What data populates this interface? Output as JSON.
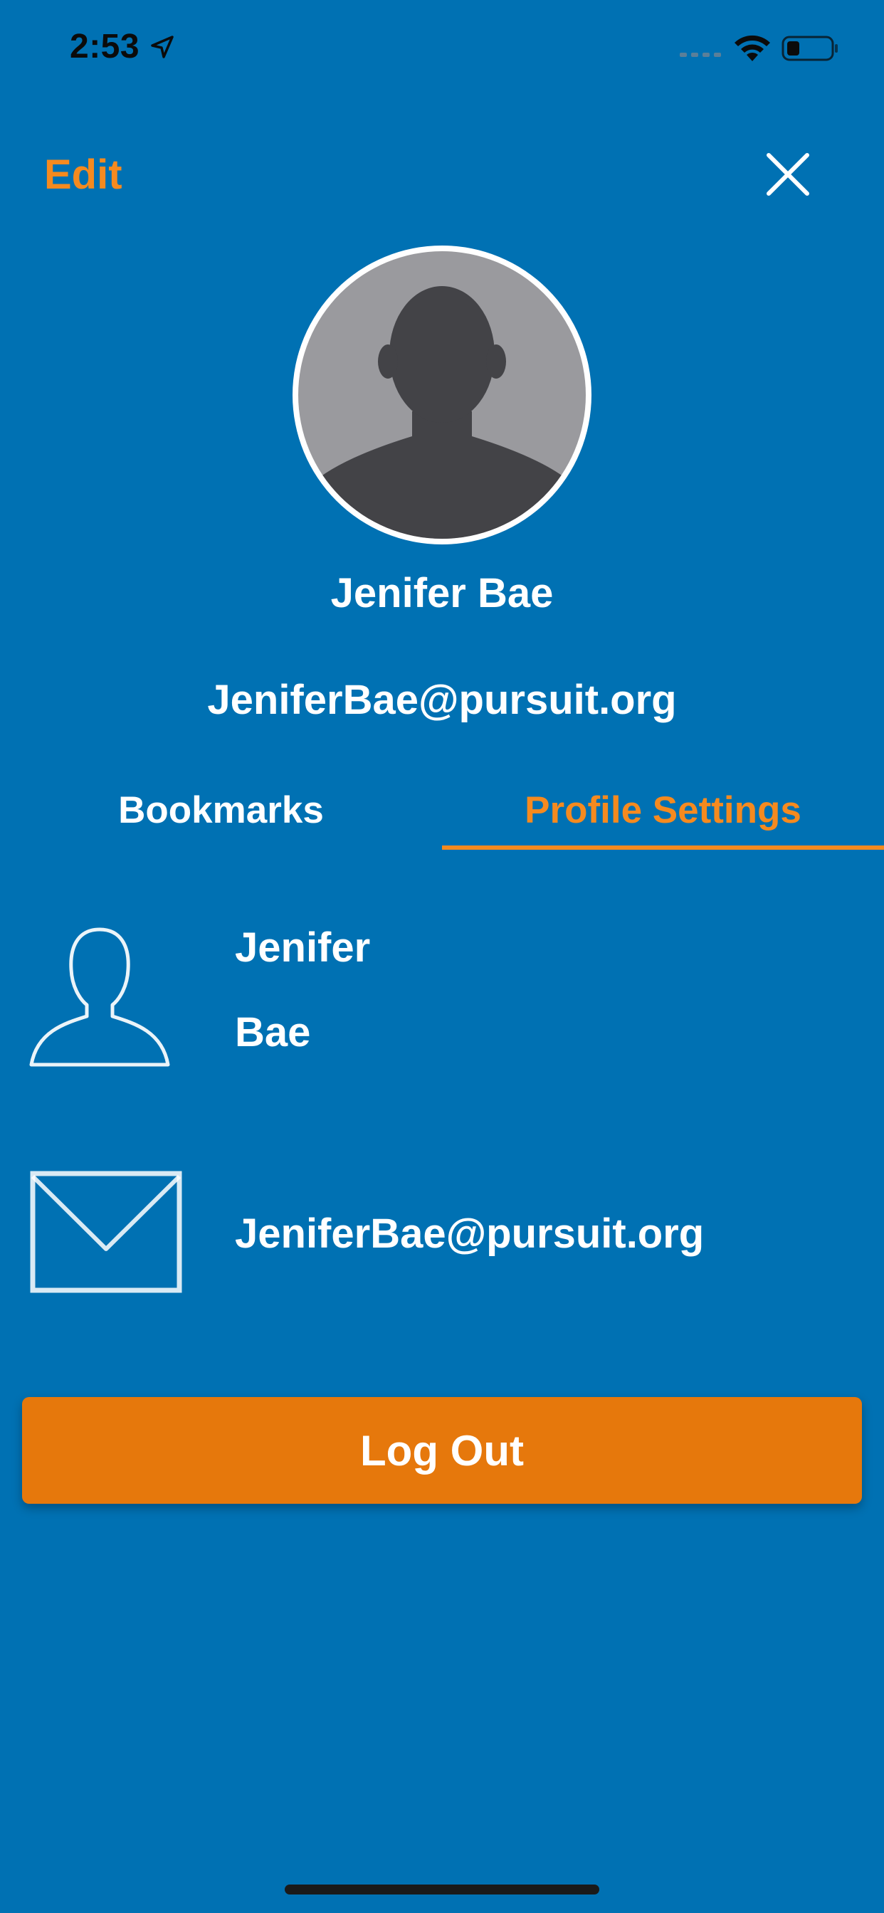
{
  "status_bar": {
    "time": "2:53"
  },
  "nav": {
    "edit_label": "Edit"
  },
  "profile": {
    "name": "Jenifer Bae",
    "email": "JeniferBae@pursuit.org"
  },
  "tabs": [
    {
      "label": "Bookmarks",
      "active": false
    },
    {
      "label": "Profile Settings",
      "active": true
    }
  ],
  "settings": {
    "first_name": "Jenifer",
    "last_name": "Bae",
    "email": "JeniferBae@pursuit.org"
  },
  "actions": {
    "logout_label": "Log Out"
  },
  "colors": {
    "background": "#0071b3",
    "accent": "#f58a1f",
    "logout_button": "#e6780c"
  }
}
